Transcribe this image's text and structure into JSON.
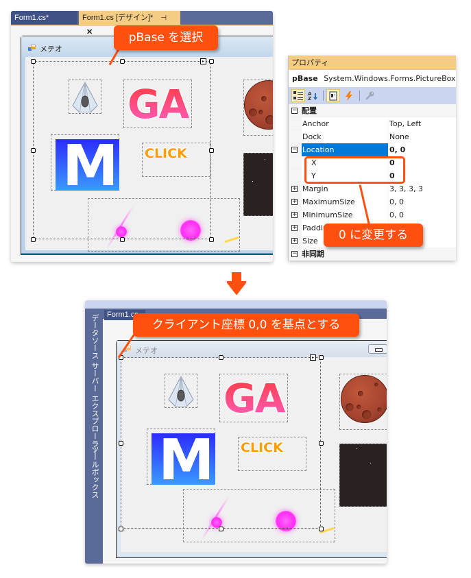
{
  "top_panel": {
    "tabs": [
      {
        "label": "Form1.cs*",
        "active": false
      },
      {
        "label": "Form1.cs [デザイン]*",
        "active": true,
        "pin_icon": "⊣",
        "close_icon": "✕"
      }
    ],
    "form": {
      "title": "メテオ",
      "sprites": {
        "ga_text": "GA",
        "m_text": "M",
        "click_text": "CLICK"
      }
    },
    "callout": "pBase を選択"
  },
  "properties": {
    "title": "プロパティ",
    "object_name": "pBase",
    "object_type": "System.Windows.Forms.PictureBox",
    "toolbar": [
      {
        "icon": "categorized-icon",
        "active": true
      },
      {
        "icon": "alphabetical-icon",
        "active": false
      },
      {
        "icon": "properties-icon",
        "active": true
      },
      {
        "icon": "events-icon",
        "active": false
      },
      {
        "icon": "property-pages-icon",
        "active": false
      }
    ],
    "rows": [
      {
        "type": "category",
        "expander": "⊟",
        "name": "配置"
      },
      {
        "type": "prop",
        "name": "Anchor",
        "value": "Top, Left"
      },
      {
        "type": "prop",
        "name": "Dock",
        "value": "None"
      },
      {
        "type": "prop",
        "name": "Location",
        "value": "0, 0",
        "expander": "⊟",
        "selected": true,
        "bold": true
      },
      {
        "type": "sub",
        "name": "X",
        "value": "0",
        "bold": true
      },
      {
        "type": "sub",
        "name": "Y",
        "value": "0",
        "bold": true
      },
      {
        "type": "prop",
        "name": "Margin",
        "value": "3, 3, 3, 3",
        "expander": "⊞"
      },
      {
        "type": "prop",
        "name": "MaximumSize",
        "value": "0, 0",
        "expander": "⊞"
      },
      {
        "type": "prop",
        "name": "MinimumSize",
        "value": "0, 0",
        "expander": "⊞"
      },
      {
        "type": "prop",
        "name": "Padding",
        "value": "",
        "expander": "⊞"
      },
      {
        "type": "prop",
        "name": "Size",
        "value": "",
        "expander": "⊞"
      },
      {
        "type": "category",
        "expander": "⊟",
        "name": "非同期"
      }
    ],
    "callout": "0 に変更する"
  },
  "bottom_panel": {
    "side_labels": [
      "データソース",
      "サーバー エクスプローラー",
      "ツールボックス"
    ],
    "tab_label": "Form1.cs",
    "form": {
      "title": "メテオ",
      "sprites": {
        "ga_text": "GA",
        "m_text": "M",
        "click_text": "CLICK"
      }
    },
    "callout": "クライアント座標 0,0 を基点とする"
  },
  "colors": {
    "accent": "#ff5010",
    "tab_active": "#f5cc84",
    "vs_blue": "#5b6b99",
    "selection": "#0078d7"
  }
}
